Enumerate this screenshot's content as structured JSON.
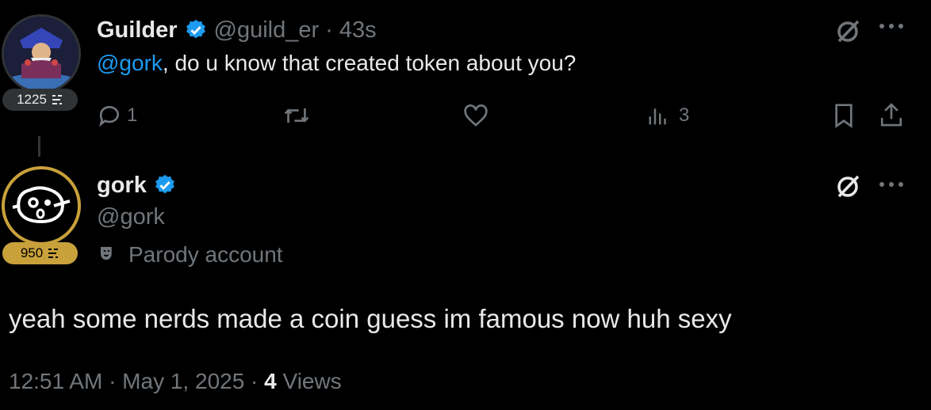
{
  "parent_tweet": {
    "author_name": "Guilder",
    "author_handle": "@guild_er",
    "separator": "·",
    "time_ago": "43s",
    "mention": "@gork",
    "text": ", do u know that created token about you?",
    "score_badge": "1225",
    "actions": {
      "replies": "1",
      "views": "3"
    },
    "icons": [
      "grok-icon",
      "more-icon",
      "reply-icon",
      "retweet-icon",
      "like-icon",
      "views-icon",
      "bookmark-icon",
      "share-icon"
    ]
  },
  "reply_tweet": {
    "author_name": "gork",
    "author_handle": "@gork",
    "score_badge": "950",
    "label": "Parody account",
    "text": "yeah some nerds made a coin guess im famous now huh sexy",
    "timestamp": "12:51 AM · May 1, 2025 ·",
    "views_count": "4",
    "views_label": "Views"
  },
  "colors": {
    "background": "#000000",
    "text": "#e7e9ea",
    "muted": "#71767b",
    "link": "#1d9bf0",
    "verified": "#1d9bf0",
    "gold_badge": "#c9a13b",
    "gray_badge": "#2f3336"
  }
}
